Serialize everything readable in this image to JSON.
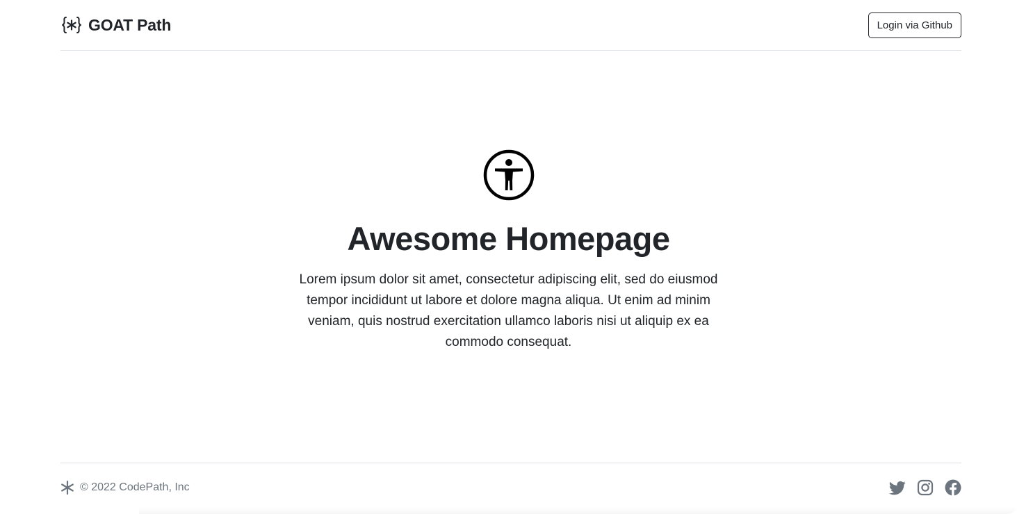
{
  "header": {
    "brand_name": "GOAT Path",
    "brand_icon": "asterisk-braces-icon",
    "login_label": "Login via Github"
  },
  "hero": {
    "icon": "universal-access-icon",
    "title": "Awesome Homepage",
    "text": "Lorem ipsum dolor sit amet, consectetur adipiscing elit, sed do eiusmod tempor incididunt ut labore et dolore magna aliqua. Ut enim ad minim veniam, quis nostrud exercitation ullamco laboris nisi ut aliquip ex ea commodo consequat."
  },
  "footer": {
    "logo_icon": "asterisk-icon",
    "copyright": "© 2022 CodePath, Inc",
    "socials": [
      {
        "icon": "twitter-icon"
      },
      {
        "icon": "instagram-icon"
      },
      {
        "icon": "facebook-icon"
      }
    ]
  },
  "colors": {
    "text": "#212529",
    "muted": "#6c757d",
    "border": "#dee2e6",
    "background": "#ffffff"
  }
}
